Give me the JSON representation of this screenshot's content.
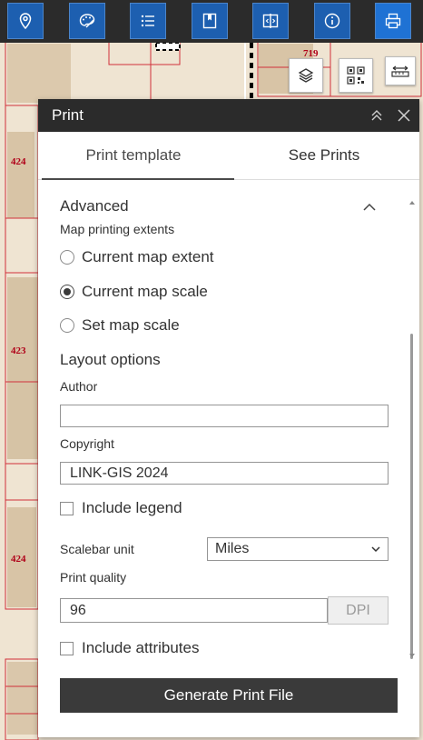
{
  "toolbar": {
    "buttons": [
      {
        "icon": "map-pin-icon",
        "label": "Location"
      },
      {
        "icon": "palette-icon",
        "label": "Basemap"
      },
      {
        "icon": "list-icon",
        "label": "Layer list"
      },
      {
        "icon": "bookmark-icon",
        "label": "Bookmarks"
      },
      {
        "icon": "swipe-icon",
        "label": "Swipe"
      },
      {
        "icon": "info-icon",
        "label": "About"
      },
      {
        "icon": "printer-icon",
        "label": "Print",
        "active": true
      }
    ]
  },
  "map": {
    "parcel_labels": [
      "719",
      "424",
      "423",
      "424"
    ]
  },
  "panel": {
    "title": "Print",
    "tabs": [
      {
        "label": "Print template",
        "active": true
      },
      {
        "label": "See Prints",
        "active": false
      }
    ],
    "advanced": {
      "title": "Advanced",
      "extents_label": "Map printing extents",
      "extent_options": [
        {
          "label": "Current map extent",
          "checked": false
        },
        {
          "label": "Current map scale",
          "checked": true
        },
        {
          "label": "Set map scale",
          "checked": false
        }
      ],
      "layout_options_title": "Layout options",
      "author_label": "Author",
      "author_value": "",
      "copyright_label": "Copyright",
      "copyright_value": "LINK-GIS 2024",
      "include_legend_label": "Include legend",
      "include_legend_checked": false,
      "scalebar_label": "Scalebar unit",
      "scalebar_value": "Miles",
      "print_quality_label": "Print quality",
      "dpi_value": "96",
      "dpi_suffix": "DPI",
      "include_attributes_label": "Include attributes",
      "include_attributes_checked": false
    },
    "generate_button": "Generate Print File"
  },
  "colors": {
    "toolbar_bg": "#2b2b2b",
    "tool_button": "#1d5fb0",
    "parcel_line": "#d0303a",
    "panel_header": "#2b2b2b",
    "primary_button": "#3a3a3a"
  }
}
